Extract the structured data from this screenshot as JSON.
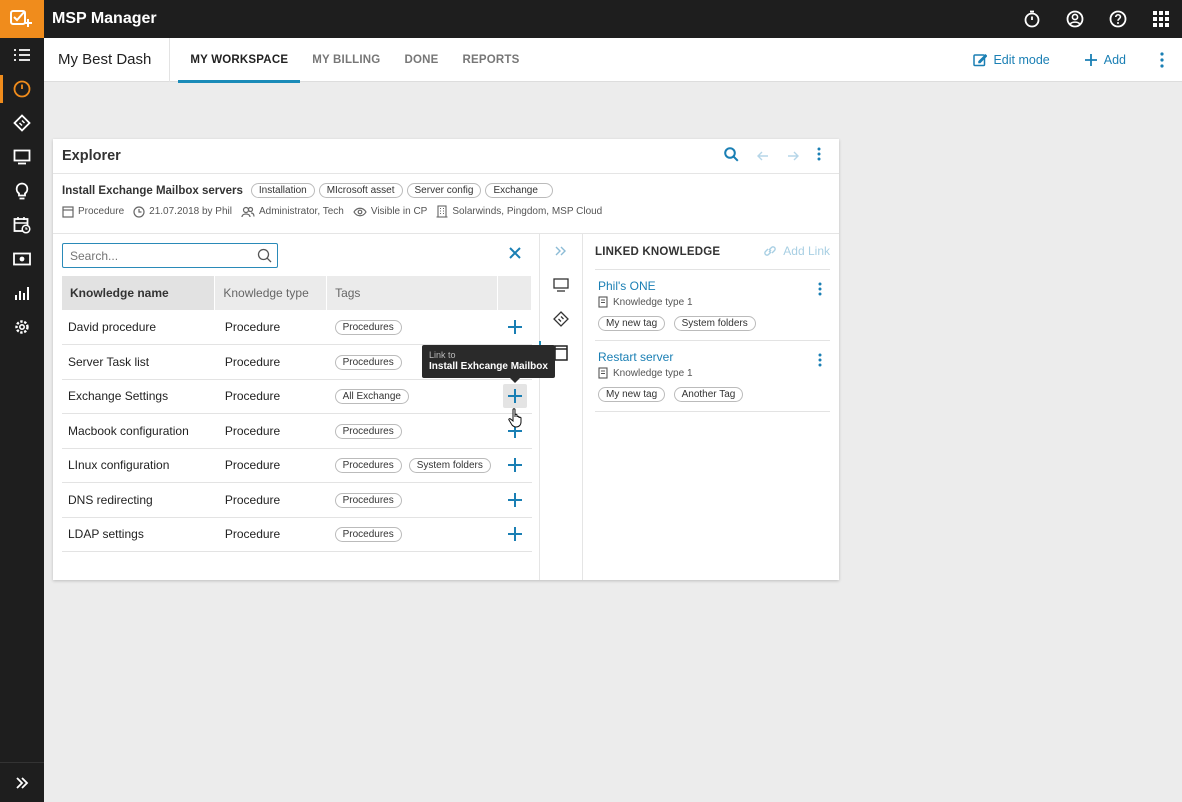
{
  "app": {
    "title": "MSP Manager",
    "colors": {
      "accent": "#f08c1c",
      "link": "#1a7fb4",
      "dark": "#1e1e1e"
    },
    "top_icons": [
      "stopwatch-icon",
      "account-icon",
      "help-icon",
      "apps-grid-icon"
    ]
  },
  "sidebar": {
    "items": [
      "menu-list-icon",
      "dashboard-clock-icon",
      "ticket-icon",
      "monitor-icon",
      "lightbulb-icon",
      "calendar-clock-icon",
      "money-icon",
      "bar-chart-icon",
      "settings-icon"
    ],
    "active": "dashboard-clock-icon",
    "expand": "double-chevron-right-icon"
  },
  "header": {
    "dash_title": "My Best Dash",
    "tabs": [
      {
        "label": "MY WORKSPACE",
        "active": true
      },
      {
        "label": "MY BILLING",
        "active": false
      },
      {
        "label": "DONE",
        "active": false
      },
      {
        "label": "REPORTS",
        "active": false
      }
    ],
    "edit_mode": "Edit mode",
    "add": "Add"
  },
  "explorer": {
    "title": "Explorer",
    "item_title": "Install Exchange Mailbox servers",
    "item_tags": [
      "Installation",
      "MIcrosoft asset",
      "Server config",
      "Exchange"
    ],
    "meta": {
      "type": "Procedure",
      "date": "21.07.2018 by Phil",
      "roles": "Administrator, Tech",
      "visibility": "Visible in CP",
      "vendors": "Solarwinds, Pingdom, MSP Cloud"
    },
    "search": {
      "placeholder": "Search...",
      "value": ""
    },
    "columns": [
      "Knowledge name",
      "Knowledge type",
      "Tags",
      ""
    ],
    "rows": [
      {
        "name": "David procedure",
        "type": "Procedure",
        "tags": [
          "Procedures"
        ]
      },
      {
        "name": "Server Task list",
        "type": "Procedure",
        "tags": [
          "Procedures"
        ]
      },
      {
        "name": "Exchange Settings",
        "type": "Procedure",
        "tags": [
          "All Exchange"
        ]
      },
      {
        "name": "Macbook configuration",
        "type": "Procedure",
        "tags": [
          "Procedures"
        ]
      },
      {
        "name": "LInux configuration",
        "type": "Procedure",
        "tags": [
          "Procedures",
          "System folders"
        ]
      },
      {
        "name": "DNS redirecting",
        "type": "Procedure",
        "tags": [
          "Procedures"
        ]
      },
      {
        "name": "LDAP settings",
        "type": "Procedure",
        "tags": [
          "Procedures"
        ]
      }
    ],
    "tooltip": {
      "line1": "Link to",
      "line2": "Install Exhcange Mailbox"
    }
  },
  "linked": {
    "title": "LINKED KNOWLEDGE",
    "add_link": "Add Link",
    "items": [
      {
        "name": "Phil's ONE",
        "type": "Knowledge type 1",
        "tags": [
          "My new tag",
          "System folders"
        ]
      },
      {
        "name": "Restart server",
        "type": "Knowledge type 1",
        "tags": [
          "My new tag",
          "Another Tag"
        ]
      }
    ]
  }
}
